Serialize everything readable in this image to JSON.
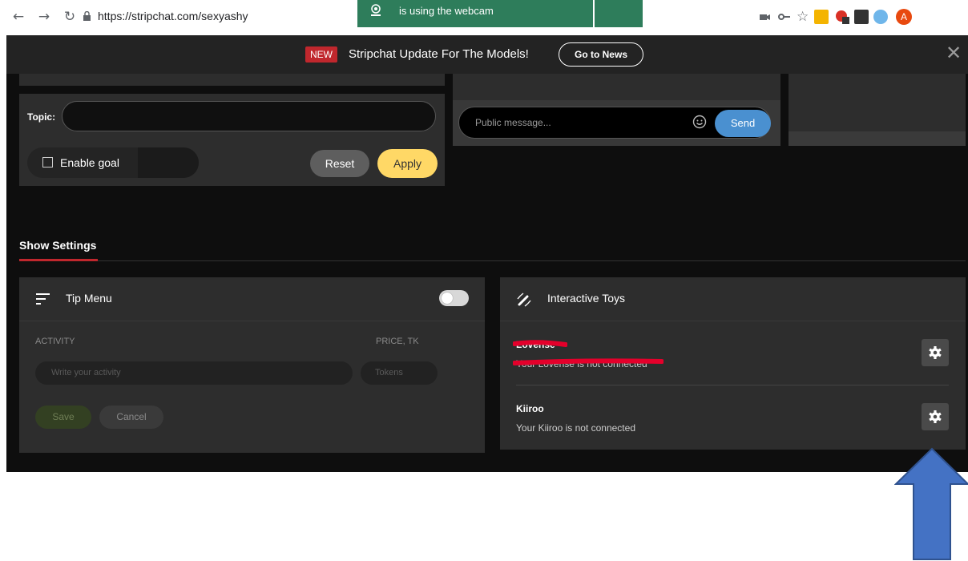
{
  "browser": {
    "url": "https://stripchat.com/sexyashy",
    "webcam_notice": "is using the webcam",
    "back_icon": "arrow-left-icon",
    "forward_icon": "arrow-right-icon",
    "reload_icon": "reload-icon",
    "profile_initial": "A"
  },
  "banner": {
    "badge": "NEW",
    "text": "Stripchat Update For The Models!",
    "button": "Go to News",
    "close": "✕"
  },
  "topic_panel": {
    "topic_label": "Topic:",
    "enable_goal_label": "Enable goal",
    "reset_label": "Reset",
    "apply_label": "Apply"
  },
  "chat": {
    "placeholder": "Public message...",
    "send_label": "Send"
  },
  "show_settings": {
    "title": "Show Settings"
  },
  "tip_menu": {
    "title": "Tip Menu",
    "enabled": true,
    "col_activity": "ACTIVITY",
    "col_price": "PRICE, TK",
    "activity_placeholder": "Write your activity",
    "tokens_placeholder": "Tokens",
    "save_label": "Save",
    "cancel_label": "Cancel"
  },
  "toys": {
    "title": "Interactive Toys",
    "items": [
      {
        "name": "Lovense",
        "status": "Your Lovense is not connected"
      },
      {
        "name": "Kiiroo",
        "status": "Your Kiiroo is not connected"
      }
    ]
  },
  "colors": {
    "accent_red": "#c0272d",
    "apply_yellow": "#ffd866",
    "send_blue": "#4a90d0",
    "annotation_arrow": "#4472c4"
  }
}
